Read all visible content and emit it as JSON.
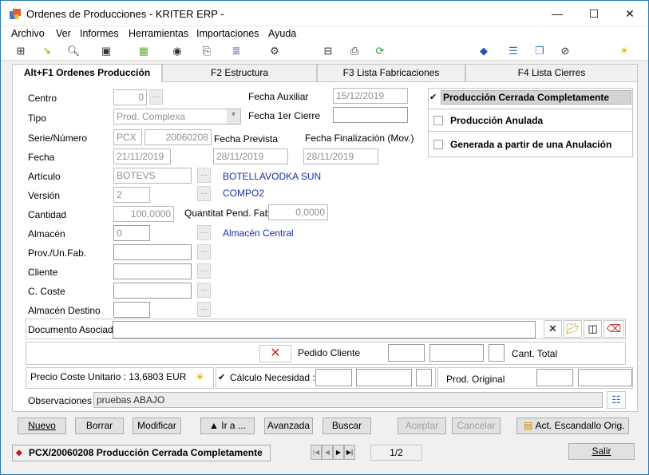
{
  "window": {
    "title": "Ordenes de Producciones - KRITER ERP -",
    "controls": {
      "minimize": "—",
      "maximize": "☐",
      "close": "✕"
    }
  },
  "menu": [
    "Archivo",
    "Ver",
    "Informes",
    "Herramientas",
    "Importaciones",
    "Ayuda"
  ],
  "toolbar_icons": [
    "tree-icon",
    "pointer-icon",
    "preview-icon",
    "zoom-icon",
    "calculator-icon",
    "globe-icon",
    "export-icon",
    "checklist-icon",
    "settings-icon",
    "tree-structure-icon",
    "print-icon",
    "refresh-icon",
    "label-icon",
    "list-icon",
    "windows-icon",
    "paperclip-icon",
    "lightbulb-icon"
  ],
  "tabs": [
    "Alt+F1 Ordenes Producción",
    "F2 Estructura",
    "F3 Lista Fabricaciones",
    "F4 Lista Cierres"
  ],
  "form": {
    "centro": {
      "label": "Centro",
      "value": "0"
    },
    "tipo": {
      "label": "Tipo",
      "value": "Prod. Complexa"
    },
    "serie": {
      "label": "Serie/Número",
      "serie": "PCX",
      "numero": "20060208"
    },
    "fecha": {
      "label": "Fecha",
      "value": "21/11/2019"
    },
    "articulo": {
      "label": "Artículo",
      "value": "BOTEVS",
      "desc": "BOTELLAVODKA SUN"
    },
    "version": {
      "label": "Versión",
      "value": "2",
      "desc": "COMPO2"
    },
    "cantidad": {
      "label": "Cantidad",
      "value": "100,0000"
    },
    "quantitat": {
      "label": "Quantitat Pend. Fab.",
      "value": "0,0000"
    },
    "almacen": {
      "label": "Almacén",
      "value": "0",
      "desc": "Almacén Central"
    },
    "prov": {
      "label": "Prov./Un.Fab."
    },
    "cliente": {
      "label": "Cliente"
    },
    "coste": {
      "label": "C. Coste"
    },
    "almacen_destino": {
      "label": "Almacén Destino"
    },
    "fecha_auxiliar": {
      "label": "Fecha Auxiliar",
      "value": "15/12/2019"
    },
    "fecha_cierre": {
      "label": "Fecha 1er Cierre",
      "value": ""
    },
    "fecha_prevista": {
      "label": "Fecha Prevista",
      "value": "28/11/2019"
    },
    "fecha_final": {
      "label": "Fecha Finalización (Mov.)",
      "value": "28/11/2019"
    },
    "dots": "..."
  },
  "status_checks": [
    {
      "label": "Producción Cerrada Completamente",
      "checked": true,
      "mark": "✔"
    },
    {
      "label": "Producción Anulada",
      "checked": false
    },
    {
      "label": "Generada a partir de una Anulación",
      "checked": false
    }
  ],
  "documento": {
    "label": "Documento Asociado",
    "icons": [
      "close-x-icon",
      "open-folder-icon",
      "preview-icon",
      "eraser-icon"
    ]
  },
  "pedido": {
    "label": "Pedido Cliente",
    "cant_total_label": "Cant. Total",
    "x": "✕"
  },
  "precio": {
    "label": "Precio Coste Unitario : 13,6803 EUR"
  },
  "calculo": {
    "label": "Cálculo Necesidad :",
    "mark": "✔"
  },
  "prod_original": {
    "label": "Prod. Original"
  },
  "observaciones": {
    "label": "Observaciones",
    "value": "pruebas ABAJO"
  },
  "buttons": {
    "nuevo": "Nuevo",
    "borrar": "Borrar",
    "modificar": "Modificar",
    "ira": "▲ Ir a ...",
    "avanzada": "Avanzada",
    "buscar": "Buscar",
    "aceptar": "Aceptar",
    "cancelar": "Cancelar",
    "escandallo": "Act. Escandallo Orig."
  },
  "status_bar": {
    "record": "PCX/20060208  Producción Cerrada Completamente",
    "nav": [
      "|◀",
      "◀",
      "▶",
      "▶|"
    ],
    "page": "1/2",
    "salir": "Salir"
  }
}
